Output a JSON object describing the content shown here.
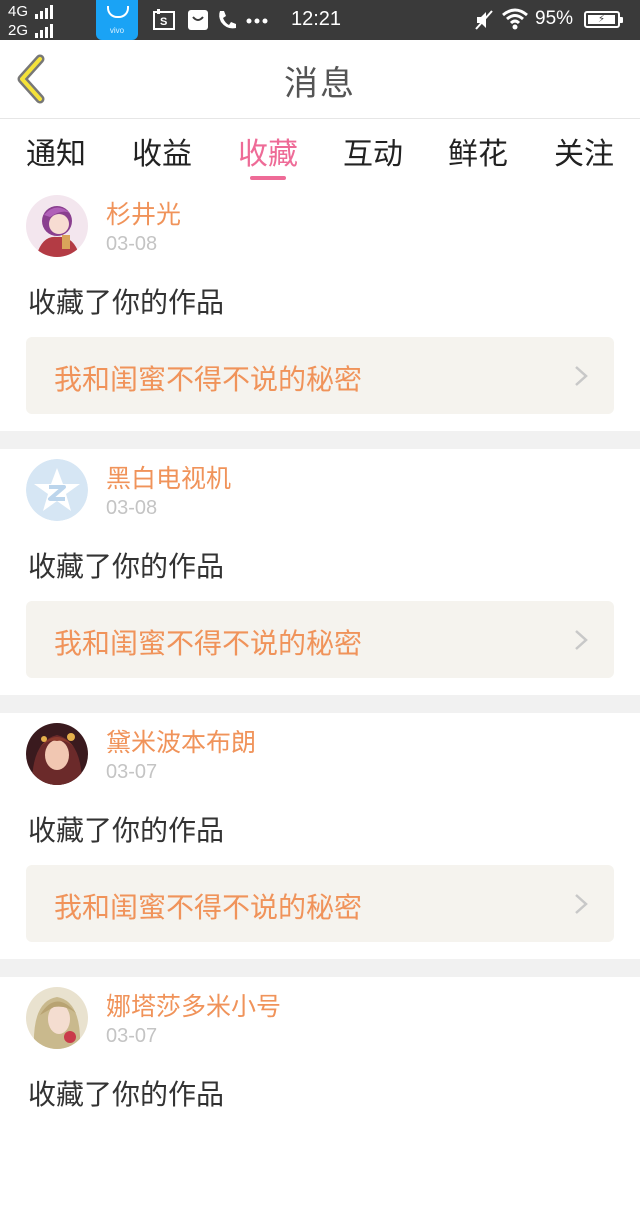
{
  "status_bar": {
    "network_1": "4G",
    "network_2": "2G",
    "time": "12:21",
    "battery_percent": "95%",
    "battery_level": 0.95,
    "vivo_label": "vivo"
  },
  "header": {
    "title": "消息",
    "back_icon": "chevron-left-icon",
    "accent_color": "#ee6b97"
  },
  "tabs": [
    {
      "label": "通知"
    },
    {
      "label": "收益"
    },
    {
      "label": "收藏",
      "active": true
    },
    {
      "label": "互动"
    },
    {
      "label": "鲜花"
    },
    {
      "label": "关注"
    }
  ],
  "messages": [
    {
      "username": "杉井光",
      "date": "03-08",
      "action": "收藏了你的作品",
      "work_title": "我和闺蜜不得不说的秘密"
    },
    {
      "username": "黑白电视机",
      "date": "03-08",
      "action": "收藏了你的作品",
      "work_title": "我和闺蜜不得不说的秘密"
    },
    {
      "username": "黛米波本布朗",
      "date": "03-07",
      "action": "收藏了你的作品",
      "work_title": "我和闺蜜不得不说的秘密"
    },
    {
      "username": "娜塔莎多米小号",
      "date": "03-07",
      "action": "收藏了你的作品",
      "work_title": ""
    }
  ],
  "colors": {
    "username": "#f0935a",
    "work_title": "#f0935a",
    "link_bg": "#f5f3ee",
    "separator": "#f1f1f1"
  }
}
